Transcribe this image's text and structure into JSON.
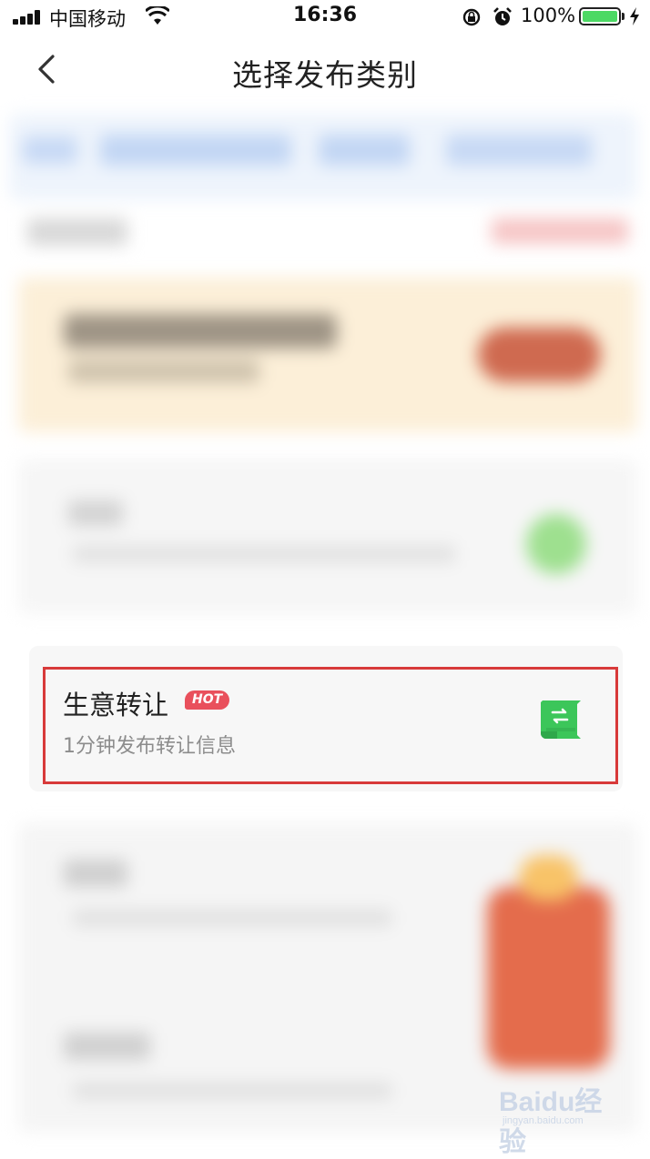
{
  "status_bar": {
    "carrier": "中国移动",
    "time": "16:36",
    "battery_percent": "100%",
    "icons": [
      "signal-icon",
      "wifi-icon",
      "orientation-lock-icon",
      "alarm-icon",
      "battery-icon",
      "charging-icon"
    ]
  },
  "nav": {
    "back_icon": "chevron-left-icon",
    "title": "选择发布类别"
  },
  "highlighted_item": {
    "title": "生意转让",
    "badge": "HOT",
    "subtitle": "1分钟发布转让信息",
    "icon": "transfer-scroll-icon",
    "highlight_color": "#d83a3a"
  },
  "watermark": {
    "text": "Baidu经验",
    "sub": "jingyan.baidu.com"
  },
  "colors": {
    "hot_badge": "#e9505c",
    "icon_green": "#3cc65a",
    "battery_green": "#4cd964"
  }
}
